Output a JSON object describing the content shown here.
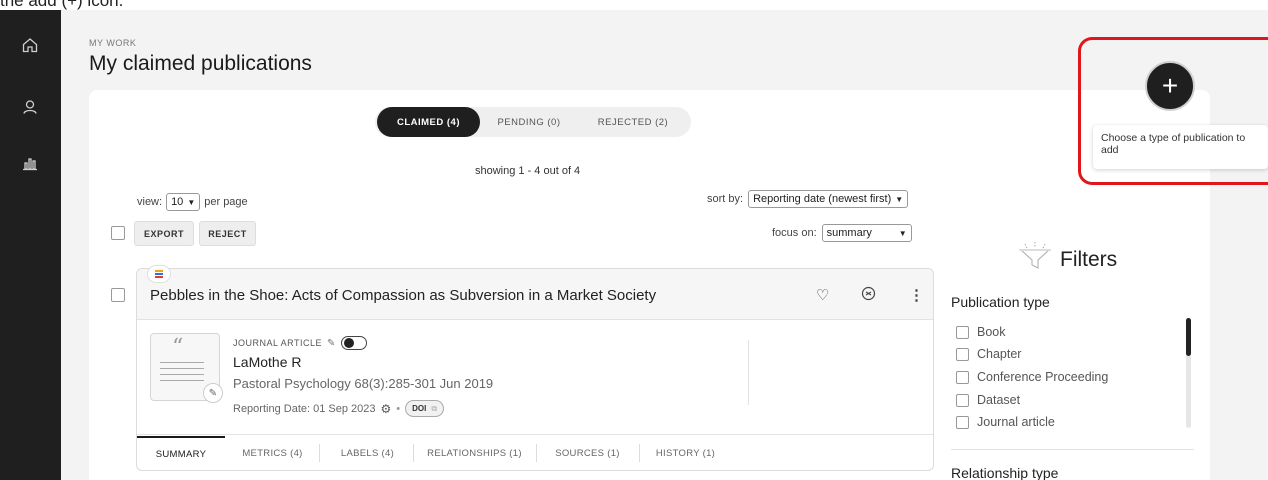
{
  "caption": "the add (+) icon.",
  "sidebar": {
    "items": [
      {
        "icon": "home-icon"
      },
      {
        "icon": "user-icon"
      },
      {
        "icon": "bar-chart-icon"
      }
    ]
  },
  "header": {
    "crumb": "MY WORK",
    "title": "My claimed publications"
  },
  "tabs": [
    {
      "label": "CLAIMED (4)",
      "active": true
    },
    {
      "label": "PENDING (0)",
      "active": false
    },
    {
      "label": "REJECTED (2)",
      "active": false
    }
  ],
  "listing": {
    "showing": "showing 1 - 4 out of 4",
    "view_label": "view:",
    "view_value": "10",
    "per_page": "per page",
    "sort_label": "sort by:",
    "sort_value": "Reporting date (newest first)",
    "focus_label": "focus on:",
    "focus_value": "summary",
    "export_label": "EXPORT",
    "reject_label": "REJECT"
  },
  "publication": {
    "title": "Pebbles in the Shoe: Acts of Compassion as Subversion in a Market Society",
    "type": "JOURNAL ARTICLE",
    "author": "LaMothe R",
    "source": "Pastoral Psychology 68(3):285-301 Jun 2019",
    "reporting_date": "Reporting Date: 01 Sep 2023",
    "doi_label": "DOI",
    "tabs": [
      {
        "label": "SUMMARY",
        "active": true
      },
      {
        "label": "METRICS (4)",
        "active": false
      },
      {
        "label": "LABELS (4)",
        "active": false
      },
      {
        "label": "RELATIONSHIPS (1)",
        "active": false
      },
      {
        "label": "SOURCES (1)",
        "active": false
      },
      {
        "label": "HISTORY (1)",
        "active": false
      }
    ]
  },
  "filters": {
    "title": "Filters",
    "publication_type_title": "Publication type",
    "publication_types": [
      "Book",
      "Chapter",
      "Conference Proceeding",
      "Dataset",
      "Journal article"
    ],
    "relationship_type_title": "Relationship type"
  },
  "add": {
    "symbol": "+",
    "tooltip": "Choose a type of publication to add"
  },
  "colors": {
    "sidebar_bg": "#1f1f1f",
    "highlight": "#e0161c",
    "active_tab_bg": "#1f1f1f"
  }
}
